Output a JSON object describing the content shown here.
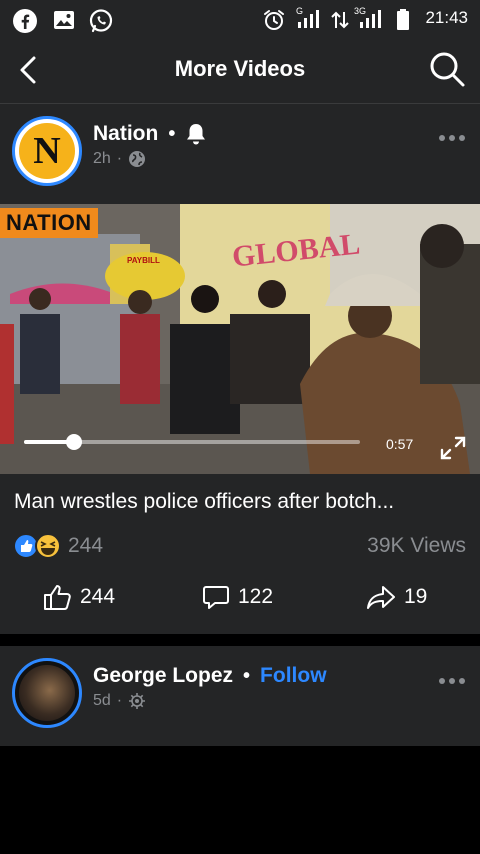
{
  "status_bar": {
    "time": "21:43",
    "network_label_1": "G",
    "network_label_2": "3G",
    "left_icons": [
      "facebook-icon",
      "image-icon",
      "whatsapp-icon"
    ],
    "right_icons": [
      "alarm-icon",
      "signal-icon",
      "data-arrows-icon",
      "signal-icon",
      "battery-icon"
    ]
  },
  "header": {
    "title": "More Videos",
    "back_icon": "chevron-left-icon",
    "search_icon": "search-icon"
  },
  "posts": [
    {
      "page_name": "Nation",
      "avatar_letter": "N",
      "time": "2h",
      "audience_icon": "globe-icon",
      "notification_icon": "bell-icon",
      "video": {
        "brand_tag": "NATION",
        "sign_text": "GLOBAL",
        "paybill_text": "PAYBILL",
        "duration": "0:57",
        "progress": 0.15
      },
      "title": "Man wrestles police officers after botch...",
      "reaction_count": "244",
      "views": "39K Views",
      "actions": {
        "like": "244",
        "comment": "122",
        "share": "19"
      }
    },
    {
      "page_name": "George Lopez",
      "follow_label": "Follow",
      "time": "5d",
      "audience_icon": "gear-icon"
    }
  ],
  "colors": {
    "background": "#000000",
    "card": "#242526",
    "accent": "#2d88ff",
    "secondary_text": "#8a8d91",
    "nation_orange": "#f08a1c"
  }
}
